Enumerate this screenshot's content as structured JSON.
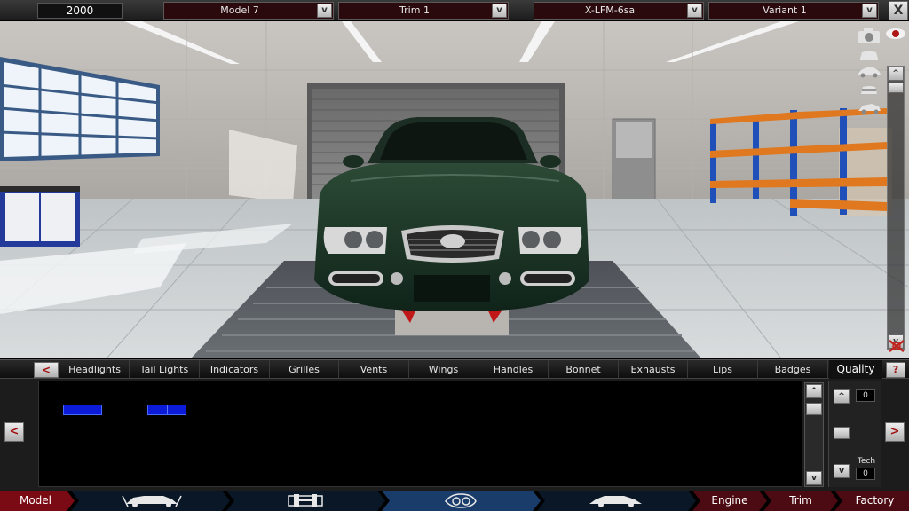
{
  "topbar": {
    "year": "2000",
    "model": "Model 7",
    "trim": "Trim 1",
    "body": "X-LFM-6sa",
    "variant": "Variant 1",
    "dropdown_arrow": "v",
    "close_label": "X"
  },
  "parts_tabs": {
    "back_label": "<",
    "tabs": [
      "Headlights",
      "Tail Lights",
      "Indicators",
      "Grilles",
      "Vents",
      "Wings",
      "Handles",
      "Bonnet",
      "Exhausts",
      "Lips",
      "Badges"
    ],
    "quality_label": "Quality",
    "help_label": "?"
  },
  "lower_panel": {
    "nav_left": "<",
    "nav_right": ">",
    "scroll_up": "^",
    "scroll_down": "v",
    "quality_up": "^",
    "quality_value": "0",
    "tech_label": "Tech",
    "tech_down": "v",
    "tech_value": "0"
  },
  "bottom_nav": {
    "items": [
      "Model",
      "Engine",
      "Trim",
      "Factory"
    ]
  },
  "icons": {
    "camera": "camera-icon",
    "eye": "eye-icon",
    "car_views": [
      "car-front-view-icon",
      "car-side-view-icon",
      "car-rear-view-icon",
      "car-top-view-icon"
    ],
    "reset": "reset-view-icon",
    "chassis": "chassis-icon",
    "suspension": "suspension-icon",
    "headlight": "headlight-icon",
    "car_body": "car-body-icon"
  },
  "colors": {
    "accent_red": "#8a0a14",
    "selection_blue": "#0c1bd8",
    "car_paint": "#1b3322"
  }
}
